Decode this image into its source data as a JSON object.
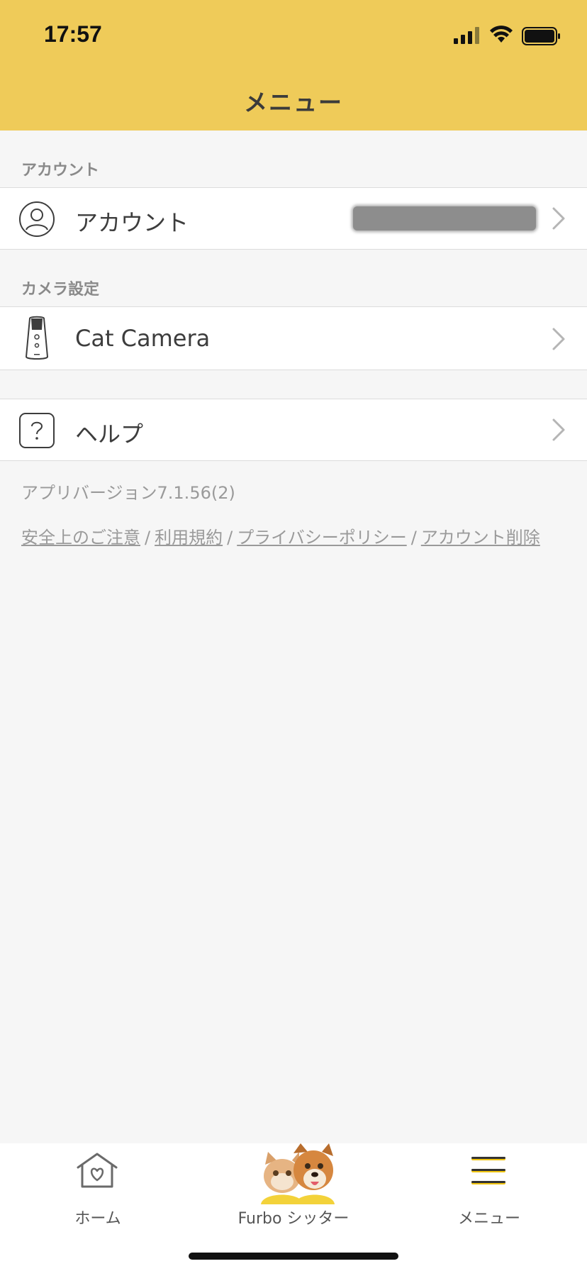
{
  "status_bar": {
    "time": "17:57"
  },
  "header": {
    "title": "メニュー"
  },
  "sections": {
    "account_header": "アカウント",
    "account_row_label": "アカウント",
    "camera_header": "カメラ設定",
    "camera_row_label": "Cat Camera",
    "help_row_label": "ヘルプ"
  },
  "footer": {
    "version": "アプリバージョン7.1.56(2)",
    "links": [
      "安全上のご注意",
      "利用規約",
      "プライバシーポリシー",
      "アカウント削除"
    ],
    "separator": "/"
  },
  "tabbar": {
    "tabs": [
      {
        "label": "ホーム",
        "icon": "home-heart-icon"
      },
      {
        "label": "Furbo シッター",
        "icon": "pets-avatar"
      },
      {
        "label": "メニュー",
        "icon": "hamburger-menu-icon"
      }
    ]
  },
  "colors": {
    "header_bg": "#efcb59",
    "background": "#f6f6f6",
    "accent_yellow": "#f1c40f"
  }
}
